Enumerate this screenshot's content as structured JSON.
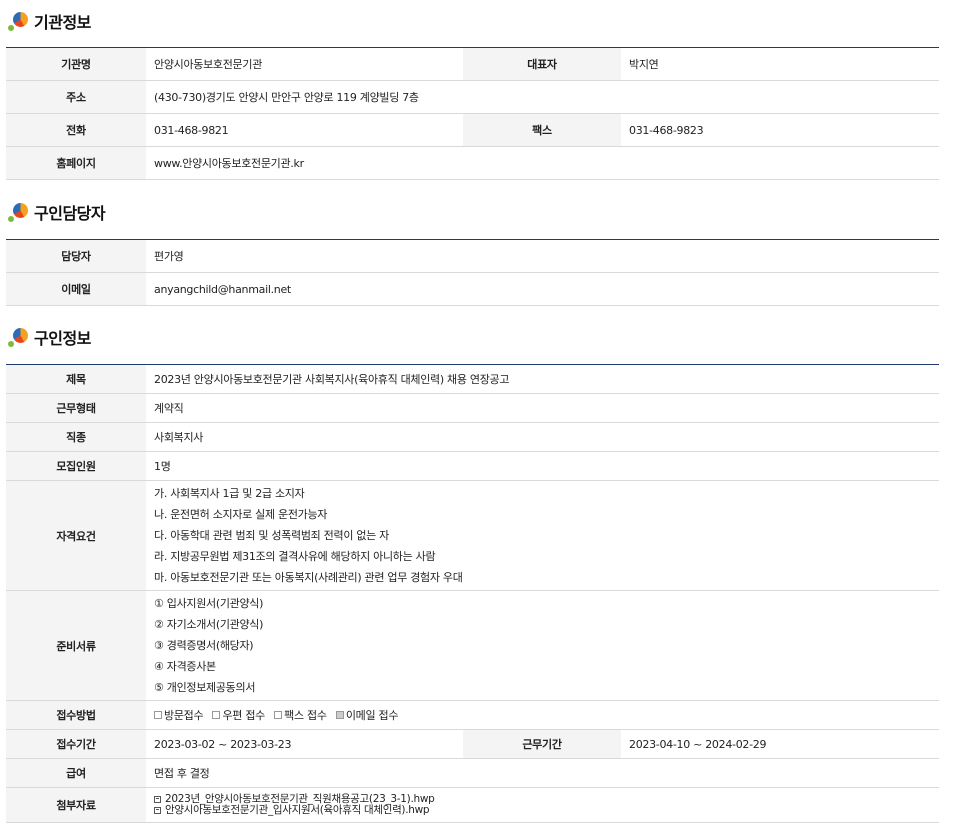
{
  "sections": {
    "agency": {
      "title": "기관정보",
      "name_label": "기관명",
      "name": "안양시아동보호전문기관",
      "rep_label": "대표자",
      "rep": "박지연",
      "addr_label": "주소",
      "addr": "(430-730)경기도 안양시 만안구 안양로 119 계양빌딩 7층",
      "tel_label": "전화",
      "tel": "031-468-9821",
      "fax_label": "팩스",
      "fax": "031-468-9823",
      "home_label": "홈페이지",
      "home": "www.안양시아동보호전문기관.kr"
    },
    "contact": {
      "title": "구인담당자",
      "person_label": "담당자",
      "person": "편가영",
      "email_label": "이메일",
      "email": "anyangchild@hanmail.net"
    },
    "job": {
      "title": "구인정보",
      "subject_label": "제목",
      "subject": "2023년 안양시아동보호전문기관 사회복지사(육아휴직 대체인력) 채용 연장공고",
      "type_label": "근무형태",
      "type": "계약직",
      "kind_label": "직종",
      "kind": "사회복지사",
      "count_label": "모집인원",
      "count": "1명",
      "qual_label": "자격요건",
      "quals": [
        "가. 사회복지사 1급 및 2급 소지자",
        "나. 운전면허 소지자로 실제 운전가능자",
        "다. 아동학대 관련 범죄 및 성폭력범죄 전력이 없는 자",
        "라. 지방공무원법 제31조의 결격사유에 해당하지 아니하는 사람",
        "마. 아동보호전문기관 또는 아동복지(사례관리) 관련 업무 경험자 우대"
      ],
      "docs_label": "준비서류",
      "docs": [
        "① 입사지원서(기관양식)",
        "② 자기소개서(기관양식)",
        "③ 경력증명서(해당자)",
        "④ 자격증사본",
        "⑤ 개인정보제공동의서"
      ],
      "method_label": "접수방법",
      "methods": [
        {
          "label": "방문접수",
          "checked": false
        },
        {
          "label": "우편 접수",
          "checked": false
        },
        {
          "label": "팩스 접수",
          "checked": false
        },
        {
          "label": "이메일 접수",
          "checked": true
        }
      ],
      "period_label": "접수기간",
      "period": "2023-03-02 ~ 2023-03-23",
      "work_period_label": "근무기간",
      "work_period": "2023-04-10 ~ 2024-02-29",
      "pay_label": "급여",
      "pay": "면접 후 결정",
      "files_label": "첨부자료",
      "files": [
        "2023년_안양시아동보호전문기관_직원채용공고(23_3-1).hwp",
        "안양시아동보호전문기관_입사지원서(육아휴직 대체인력).hwp"
      ]
    }
  }
}
